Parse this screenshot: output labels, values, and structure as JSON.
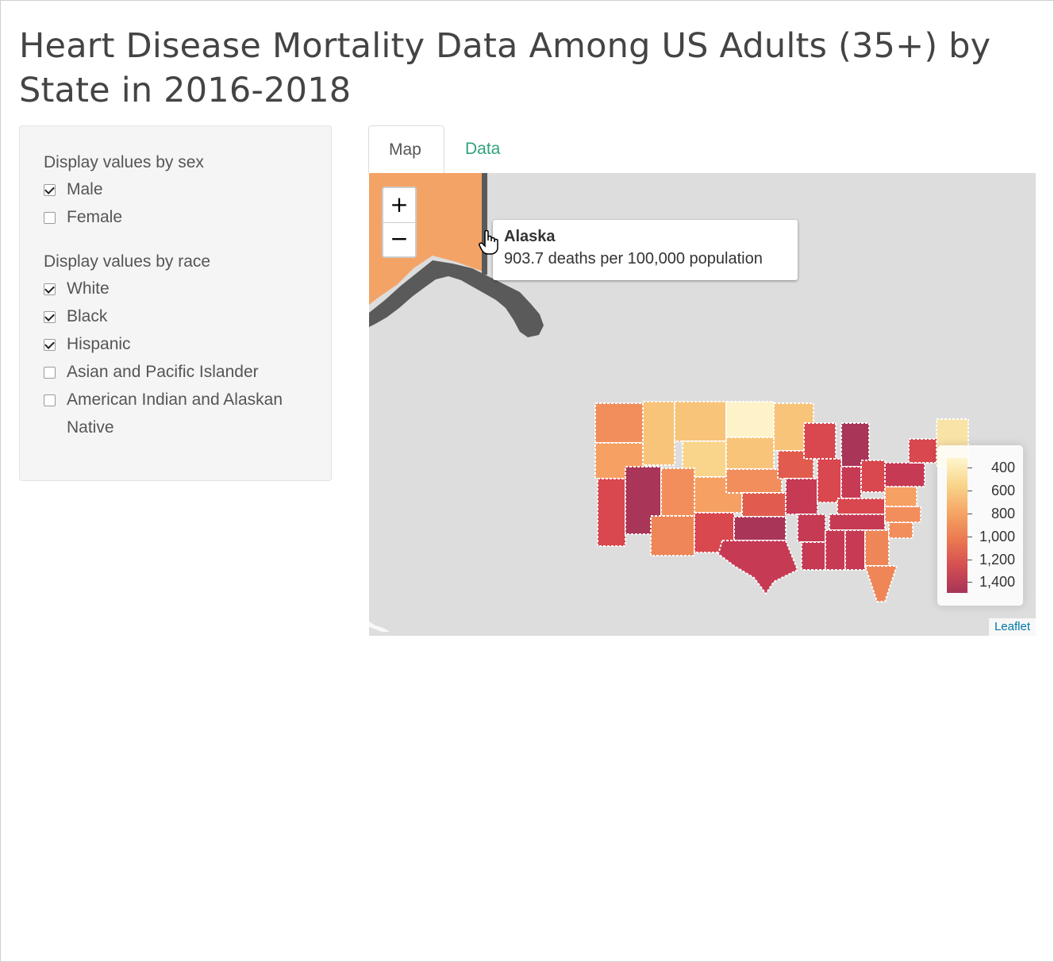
{
  "page": {
    "title": "Heart Disease Mortality Data Among US Adults (35+) by State in 2016-2018"
  },
  "sidebar": {
    "sex_label": "Display values by sex",
    "sex_options": [
      {
        "label": "Male",
        "checked": true
      },
      {
        "label": "Female",
        "checked": false
      }
    ],
    "race_label": "Display values by race",
    "race_options": [
      {
        "label": "White",
        "checked": true
      },
      {
        "label": "Black",
        "checked": true
      },
      {
        "label": "Hispanic",
        "checked": true
      },
      {
        "label": "Asian and Pacific Islander",
        "checked": false
      },
      {
        "label": "American Indian and Alaskan Native",
        "checked": false
      }
    ]
  },
  "tabs": {
    "map": "Map",
    "data": "Data",
    "active": "Map",
    "inactive_color": "#2fa37a"
  },
  "map": {
    "zoom_in": "+",
    "zoom_out": "−",
    "tooltip": {
      "title": "Alaska",
      "text": "903.7 deaths per 100,000 population"
    },
    "legend": {
      "labels": [
        "400",
        "600",
        "800",
        "1,000",
        "1,200",
        "1,400"
      ],
      "color_low": "#fef6cf",
      "color_high": "#a73458"
    },
    "attribution": "Leaflet",
    "background_color": "#dddddd",
    "alaska_color": "#f4a366",
    "state_colors": [
      "#f6a063",
      "#f8c47a",
      "#fbe9b7",
      "#fdf2c8",
      "#ee8657",
      "#d9474f",
      "#a93559",
      "#c73a54",
      "#e15c4e",
      "#f28e5c"
    ]
  }
}
